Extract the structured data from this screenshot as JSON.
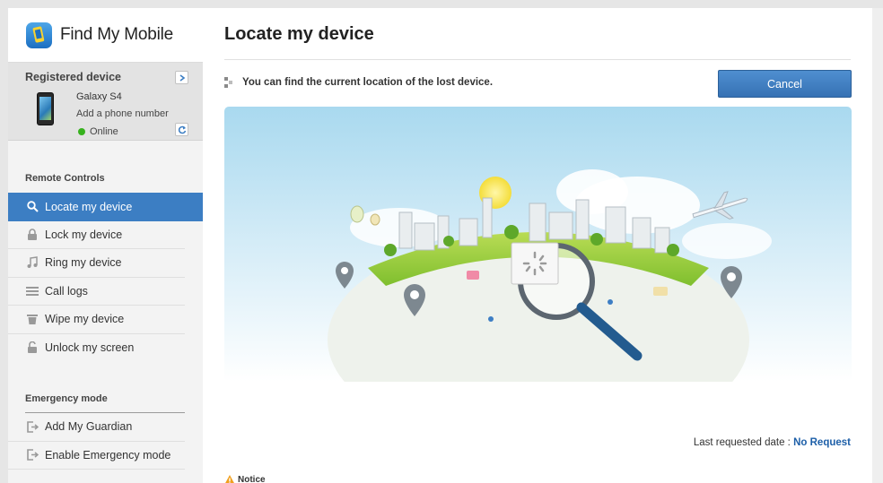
{
  "app": {
    "title": "Find My Mobile"
  },
  "device": {
    "section_label": "Registered device",
    "name": "Galaxy S4",
    "add_phone": "Add a phone number",
    "status": "Online"
  },
  "sidebar": {
    "remote_controls_label": "Remote Controls",
    "remote_items": [
      {
        "label": "Locate my device",
        "icon": "search-icon",
        "active": true
      },
      {
        "label": "Lock my device",
        "icon": "lock-icon"
      },
      {
        "label": "Ring my device",
        "icon": "music-note-icon"
      },
      {
        "label": "Call logs",
        "icon": "list-icon"
      },
      {
        "label": "Wipe my device",
        "icon": "trash-icon"
      },
      {
        "label": "Unlock my screen",
        "icon": "unlock-icon"
      }
    ],
    "emergency_label": "Emergency mode",
    "emergency_items": [
      {
        "label": "Add My Guardian",
        "icon": "exit-door-icon"
      },
      {
        "label": "Enable Emergency mode",
        "icon": "exit-door-icon"
      }
    ]
  },
  "main": {
    "title": "Locate my device",
    "info": "You can find the current location of the lost device.",
    "cancel_label": "Cancel",
    "last_requested_label": "Last requested date :",
    "last_requested_value": "No Request",
    "notice_label": "Notice"
  },
  "colors": {
    "accent": "#3c7ec3",
    "online": "#37b21e",
    "link": "#1d5fa8"
  }
}
